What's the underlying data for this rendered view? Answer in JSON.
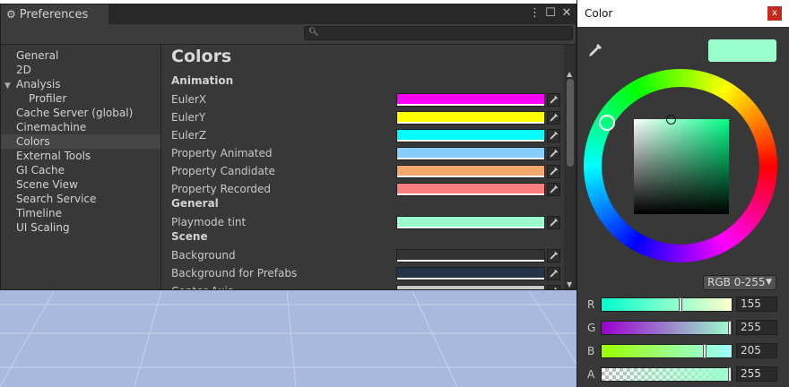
{
  "preferences": {
    "title": "Preferences",
    "search": {
      "value": "",
      "placeholder": ""
    },
    "sidebar": {
      "items": [
        {
          "label": "General",
          "level": "top"
        },
        {
          "label": "2D",
          "level": "top"
        },
        {
          "label": "Analysis",
          "level": "parent"
        },
        {
          "label": "Profiler",
          "level": "sub"
        },
        {
          "label": "Cache Server (global)",
          "level": "top"
        },
        {
          "label": "Cinemachine",
          "level": "top"
        },
        {
          "label": "Colors",
          "level": "top",
          "selected": true
        },
        {
          "label": "External Tools",
          "level": "top"
        },
        {
          "label": "GI Cache",
          "level": "top"
        },
        {
          "label": "Scene View",
          "level": "top"
        },
        {
          "label": "Search Service",
          "level": "top"
        },
        {
          "label": "Timeline",
          "level": "top"
        },
        {
          "label": "UI Scaling",
          "level": "top"
        }
      ]
    },
    "content": {
      "title": "Colors",
      "sections": [
        {
          "name": "Animation",
          "rows": [
            {
              "label": "EulerX",
              "color": "#ff00ff"
            },
            {
              "label": "EulerY",
              "color": "#ffff00"
            },
            {
              "label": "EulerZ",
              "color": "#00ffff"
            },
            {
              "label": "Property Animated",
              "color": "#87cdf9"
            },
            {
              "label": "Property Candidate",
              "color": "#f8a66c"
            },
            {
              "label": "Property Recorded",
              "color": "#f97e80"
            }
          ]
        },
        {
          "name": "General",
          "rows": [
            {
              "label": "Playmode tint",
              "color": "#9bffcd"
            }
          ]
        },
        {
          "name": "Scene",
          "rows": [
            {
              "label": "Background",
              "color": "#333333"
            },
            {
              "label": "Background for Prefabs",
              "color": "#243446"
            },
            {
              "label": "Center Axis",
              "color": "#c8c8c8"
            }
          ]
        }
      ]
    }
  },
  "color_picker": {
    "title": "Color",
    "close_label": "x",
    "preview_color": "#9bffcd",
    "mode": "RGB 0-255",
    "channels": [
      {
        "name": "R",
        "value": "155",
        "fraction": 0.608
      },
      {
        "name": "G",
        "value": "255",
        "fraction": 1.0
      },
      {
        "name": "B",
        "value": "205",
        "fraction": 0.804
      },
      {
        "name": "A",
        "value": "255",
        "fraction": 1.0
      }
    ]
  }
}
